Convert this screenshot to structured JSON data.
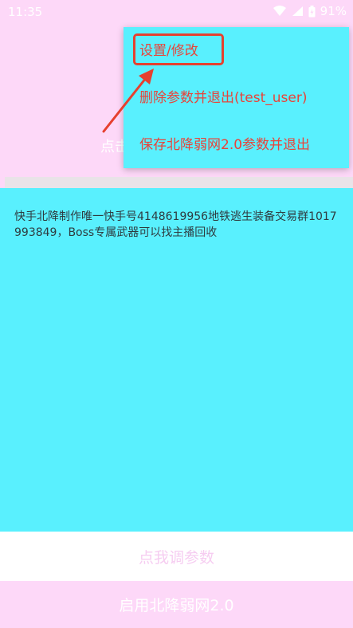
{
  "status_bar": {
    "time": "11:35",
    "battery_text": "91%",
    "icons": [
      "wifi-icon",
      "signal-icon",
      "battery-icon"
    ]
  },
  "background_hint": "点击",
  "menu": {
    "items": [
      {
        "label": "设置/修改"
      },
      {
        "label": "删除参数并退出(test_user)"
      },
      {
        "label": "保存北降弱网2.0参数并退出"
      }
    ]
  },
  "content": {
    "info_text": "快手北降制作唯一快手号4148619956地铁逃生装备交易群1017993849，Boss专属武器可以找主播回收"
  },
  "buttons": {
    "adjust_label": "点我调参数",
    "enable_label": "启用北降弱网2.0"
  },
  "colors": {
    "background": "#fdd8f8",
    "panel": "#59f0fe",
    "menu_text": "#e8443a",
    "highlight": "#e6402f",
    "adjust_text": "#f6cdf1"
  }
}
